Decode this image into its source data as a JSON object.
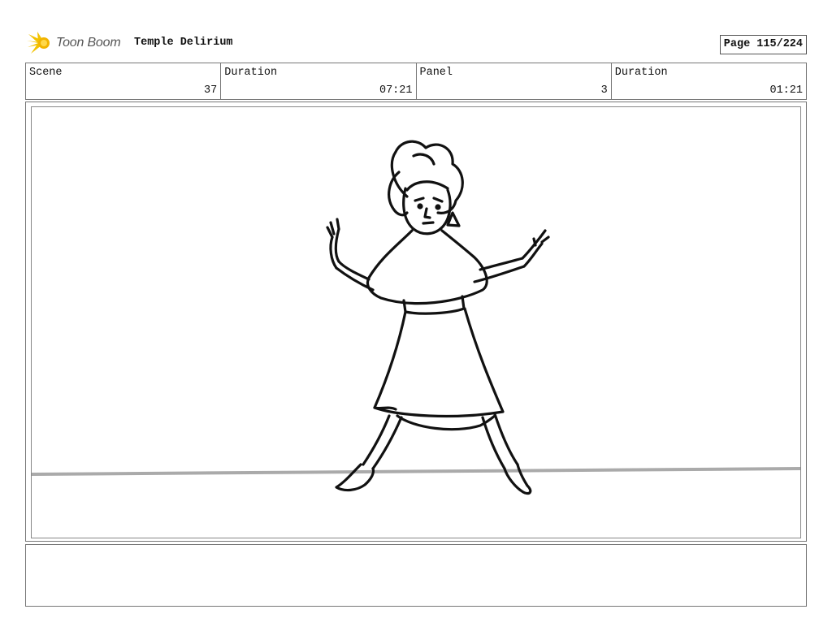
{
  "header": {
    "logo_text": "Toon Boom",
    "project_title": "Temple Delirium",
    "page_label": "Page 115/224"
  },
  "info": {
    "scene_label": "Scene",
    "scene_value": "37",
    "scene_duration_label": "Duration",
    "scene_duration_value": "07:21",
    "panel_label": "Panel",
    "panel_value": "3",
    "panel_duration_label": "Duration",
    "panel_duration_value": "01:21"
  },
  "panel": {
    "ground_line_color": "#aaaaaa",
    "ink_color": "#111111"
  },
  "notes": {
    "text": ""
  }
}
